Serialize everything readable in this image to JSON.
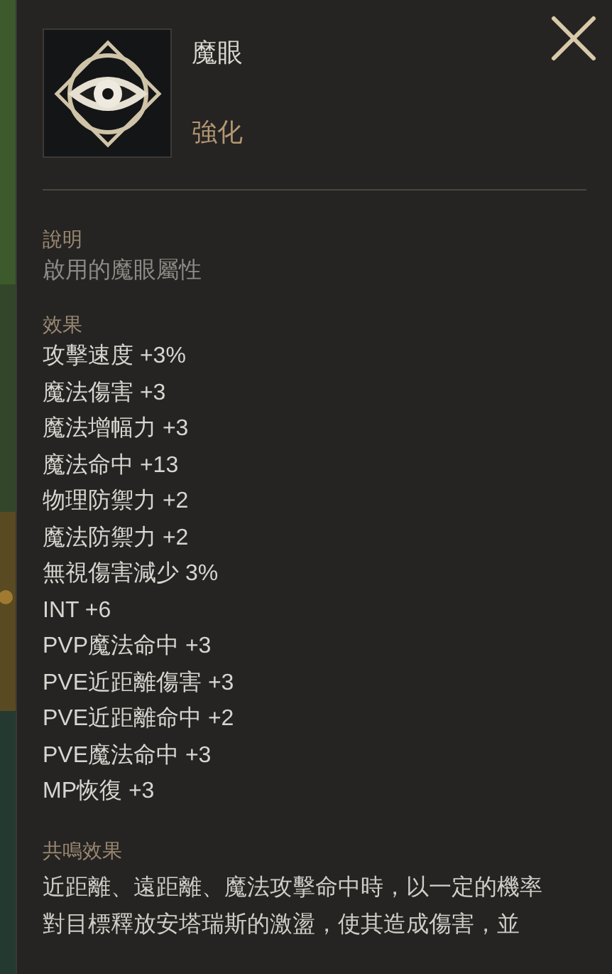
{
  "item": {
    "name": "魔眼",
    "grade": "強化"
  },
  "description": {
    "label": "說明",
    "text": "啟用的魔眼屬性"
  },
  "effects": {
    "label": "效果",
    "lines": [
      "攻擊速度 +3%",
      "魔法傷害 +3",
      "魔法增幅力 +3",
      "魔法命中 +13",
      "物理防禦力 +2",
      "魔法防禦力 +2",
      "無視傷害減少 3%",
      "INT +6",
      "PVP魔法命中 +3",
      "PVE近距離傷害 +3",
      "PVE近距離命中 +2",
      "PVE魔法命中 +3",
      "MP恢復 +3"
    ]
  },
  "resonance": {
    "label": "共鳴效果",
    "lines": [
      "近距離、遠距離、魔法攻擊命中時，以一定的機率",
      "對目標釋放安塔瑞斯的激盪，使其造成傷害，並"
    ]
  }
}
